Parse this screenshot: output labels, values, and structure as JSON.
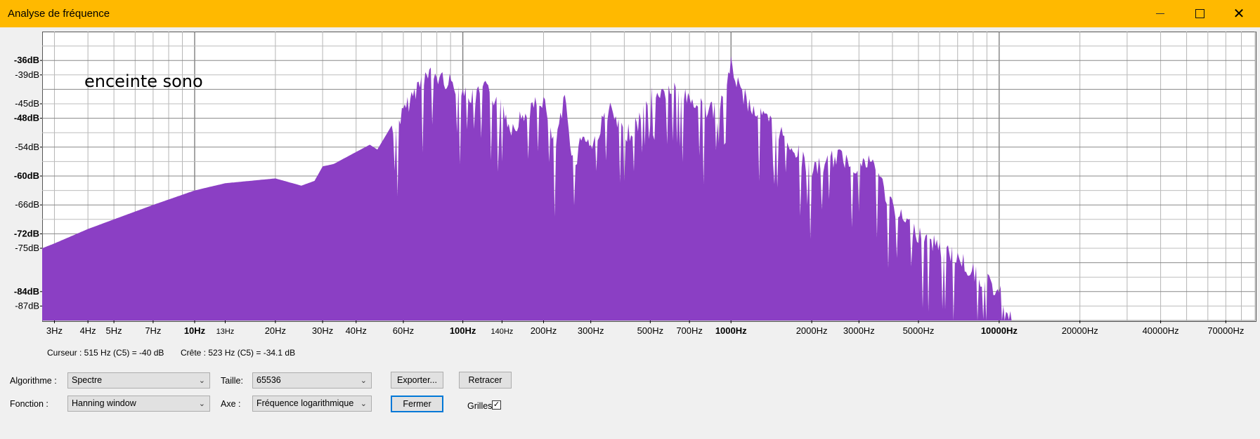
{
  "window": {
    "title": "Analyse de fréquence",
    "minimize_icon": "minimize-icon",
    "maximize_icon": "maximize-icon",
    "close_icon": "close-icon",
    "accent": "#ffb900"
  },
  "chart_data": {
    "type": "area",
    "color": "#8b3fc4",
    "xscale": "log",
    "annotation": "enceinte sono",
    "ylim": [
      -90,
      -30
    ],
    "y_ticks": [
      "-36dB",
      "-39dB",
      "-45dB",
      "-48dB",
      "-54dB",
      "-60dB",
      "-66dB",
      "-72dB",
      "-75dB",
      "-84dB",
      "-87dB"
    ],
    "x_ticks": [
      "3Hz",
      "4Hz",
      "5Hz",
      "7Hz",
      "10Hz",
      "13Hz",
      "20Hz",
      "30Hz",
      "40Hz",
      "60Hz",
      "100Hz",
      "140Hz",
      "200Hz",
      "300Hz",
      "500Hz",
      "700Hz",
      "1000Hz",
      "2000Hz",
      "3000Hz",
      "5000Hz",
      "10000Hz",
      "20000Hz",
      "40000Hz",
      "70000Hz"
    ],
    "grid": true,
    "x": [
      2.7,
      3,
      4,
      5,
      7,
      10,
      13,
      20,
      25,
      28,
      30,
      33,
      40,
      45,
      48,
      55,
      60,
      70,
      75,
      85,
      100,
      110,
      120,
      140,
      150,
      200,
      220,
      240,
      260,
      280,
      300,
      350,
      400,
      450,
      500,
      550,
      600,
      700,
      800,
      900,
      1000,
      1100,
      1200,
      1400,
      1600,
      2000,
      2500,
      3000,
      3300,
      3500,
      4000,
      5000,
      6000,
      7000,
      8000,
      10000,
      11000,
      11500
    ],
    "y": [
      -75,
      -74,
      -71,
      -69,
      -66,
      -63,
      -61.5,
      -60.5,
      -62,
      -61,
      -58,
      -57.5,
      -55,
      -53.5,
      -54.5,
      -49,
      -45,
      -38,
      -37,
      -38,
      -40,
      -42,
      -40,
      -43,
      -48,
      -42,
      -53,
      -42,
      -56,
      -49,
      -52,
      -44,
      -50,
      -47,
      -40,
      -41,
      -40,
      -42,
      -44,
      -45,
      -35,
      -41,
      -44,
      -47,
      -50,
      -57,
      -54,
      -56,
      -55,
      -57,
      -65,
      -70,
      -73,
      -75,
      -78,
      -82,
      -87,
      -90
    ]
  },
  "status": {
    "cursor": "Curseur : 515 Hz (C5) = -40 dB",
    "peak": "Crête : 523 Hz (C5) = -34.1 dB"
  },
  "controls": {
    "algorithm_label": "Algorithme :",
    "algorithm_value": "Spectre",
    "size_label": "Taille:",
    "size_value": "65536",
    "function_label": "Fonction :",
    "function_value": "Hanning window",
    "axis_label": "Axe :",
    "axis_value": "Fréquence logarithmique",
    "export_label": "Exporter...",
    "replot_label": "Retracer",
    "close_label": "Fermer",
    "grids_label": "Grilles",
    "grids_checked": true,
    "dropdown_icon": "chevron-down-icon"
  }
}
